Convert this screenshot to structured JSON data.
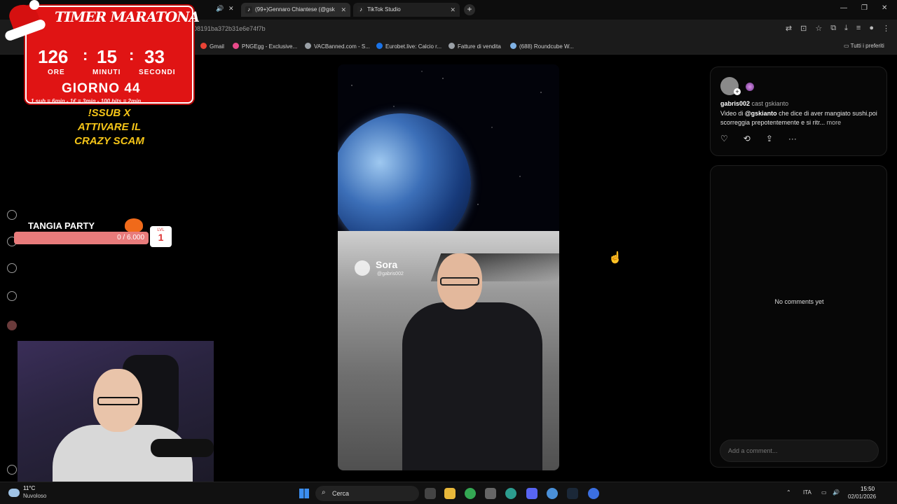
{
  "browser": {
    "tabs": [
      {
        "label": "(99+)Gennaro Chiantese (@gsk",
        "icon": "tiktok-icon"
      },
      {
        "label": "TikTok Studio",
        "icon": "tiktok-icon"
      }
    ],
    "new_tab": "+",
    "url": "08191ba372b31e6e74f7b",
    "bookmarks": [
      {
        "label": "Gmail",
        "color": "#ea4335"
      },
      {
        "label": "PNGEgg - Exclusive...",
        "color": "#e84a8a"
      },
      {
        "label": "VACBanned.com - S...",
        "color": "#9aa0a6"
      },
      {
        "label": "Eurobet.live: Calcio r...",
        "color": "#1a73e8"
      },
      {
        "label": "Fatture di vendita",
        "color": "#9aa0a6"
      },
      {
        "label": "(688) Roundcube W...",
        "color": "#7fb2e5"
      }
    ],
    "all_bookmarks": "Tutti i preferiti"
  },
  "overlay": {
    "timer_title": "TIMER MARATONA",
    "hours": "126",
    "minutes": "15",
    "seconds": "33",
    "hours_label": "ORE",
    "minutes_label": "MINUTI",
    "seconds_label": "SECONDI",
    "day": "GIORNO 44",
    "rates": "1 sub = 6min - 1€ = 3min - 100 bits = 2min",
    "promo_line1": "!SSUB X",
    "promo_line2": "ATTIVARE IL",
    "promo_line3": "CRAZY SCAM",
    "tangia_title": "TANGIA PARTY",
    "tangia_progress": "0 / 6.000",
    "tangia_progress_fraction": 0,
    "lvl_label": "LVL",
    "lvl_value": "1"
  },
  "video": {
    "watermark_name": "Sora",
    "watermark_handle": "@gabris002"
  },
  "post": {
    "author": "gabris002",
    "cast": "cast gskianto",
    "description_prefix": "Video di ",
    "description_mention": "@gskianto",
    "description_rest": " che dice di aver mangiato sushi.poi scorreggia prepotentemente e si ritr...",
    "more": "more",
    "actions": [
      "like-icon",
      "remix-icon",
      "share-icon",
      "more-icon"
    ]
  },
  "comments": {
    "empty_text": "No comments yet",
    "input_placeholder": "Add a comment..."
  },
  "taskbar": {
    "temperature": "11°C",
    "weather": "Nuvoloso",
    "search_label": "Cerca",
    "language": "ITA",
    "time": "15:50",
    "date": "02/01/2026"
  }
}
